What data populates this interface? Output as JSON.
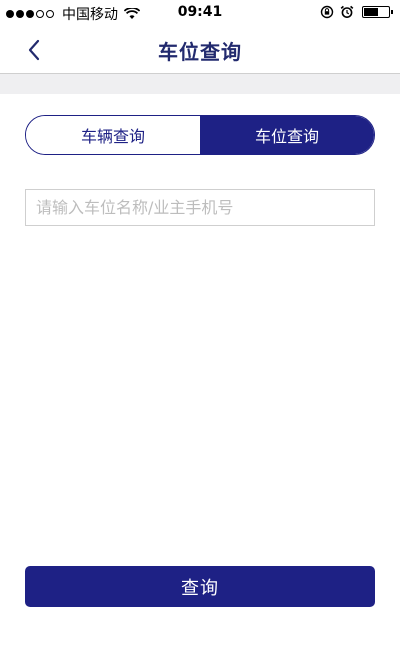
{
  "status_bar": {
    "carrier": "中国移动",
    "time": "09:41",
    "signal_bars_full": 3,
    "signal_bars_total": 5,
    "battery_level": 0.6
  },
  "nav": {
    "title": "车位查询",
    "back_icon": "chevron-left-icon"
  },
  "tabs": [
    {
      "label": "车辆查询",
      "active": false
    },
    {
      "label": "车位查询",
      "active": true
    }
  ],
  "search": {
    "value": "",
    "placeholder": "请输入车位名称/业主手机号"
  },
  "actions": {
    "query_label": "查询"
  },
  "colors": {
    "primary": "#1e2185",
    "title_text": "#222a6e",
    "placeholder": "#bdbdbd",
    "band": "#efeff1"
  }
}
